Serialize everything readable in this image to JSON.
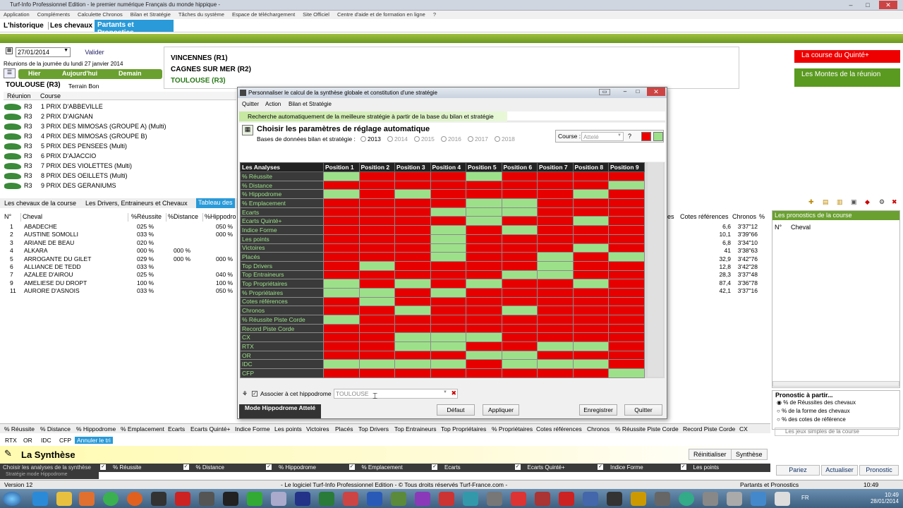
{
  "window": {
    "title": "Turf-Info Professionnel Edition - le premier numérique Français du monde hippique -"
  },
  "menu": [
    "Application",
    "Compléments",
    "Calculette Chronos",
    "Bilan et Stratégie",
    "Tâches du système",
    "Espace de téléchargement",
    "Site Officiel",
    "Centre d'aide et de formation en ligne",
    "?"
  ],
  "nav": {
    "historique": "L'historique",
    "chevaux": "Les chevaux",
    "partants": "Partants et Pronostics"
  },
  "date": {
    "value": "27/01/2014",
    "valider": "Valider",
    "reunions_label": "Réunions de la journée du lundi 27 janvier 2014",
    "hier": "Hier",
    "aujourdhui": "Aujourd'hui",
    "demain": "Demain"
  },
  "reunions": [
    "VINCENNES (R1)",
    "CAGNES SUR MER (R2)",
    "TOULOUSE (R3)"
  ],
  "selected": {
    "name": "TOULOUSE (R3)",
    "terrain": "Terrain Bon"
  },
  "courses_header": {
    "reunion": "Réunion",
    "course": "Course"
  },
  "courses": [
    {
      "r": "R3",
      "c": "1 PRIX D'ABBEVILLE"
    },
    {
      "r": "R3",
      "c": "2 PRIX D'AIGNAN"
    },
    {
      "r": "R3",
      "c": "3 PRIX DES MIMOSAS (GROUPE A) (Multi)"
    },
    {
      "r": "R3",
      "c": "4 PRIX DES MIMOSAS (GROUPE B)"
    },
    {
      "r": "R3",
      "c": "5 PRIX DES PENSEES (Multi)"
    },
    {
      "r": "R3",
      "c": "6 PRIX D'AJACCIO"
    },
    {
      "r": "R3",
      "c": "7 PRIX DES VIOLETTES (Multi)"
    },
    {
      "r": "R3",
      "c": "8 PRIX DES OEILLETS (Multi)"
    },
    {
      "r": "R3",
      "c": "9 PRIX DES GERANIUMS"
    }
  ],
  "right_links": {
    "quinte": "La course du Quinté+",
    "montes": "Les Montes de la réunion"
  },
  "tabs": {
    "chevaux": "Les chevaux de la course",
    "drivers": "Les Drivers, Entraineurs et Chevaux",
    "tableau": "Tableau des"
  },
  "horses_header": {
    "num": "N°",
    "cheval": "Cheval",
    "reussite": "%Réussite",
    "distance": "%Distance",
    "hippo": "%Hippodro"
  },
  "horses": [
    {
      "n": "1",
      "name": "ABADECHE",
      "r": "025 %",
      "d": "",
      "h": "050 %"
    },
    {
      "n": "2",
      "name": "AUSTINE SOMOLLI",
      "r": "033 %",
      "d": "",
      "h": "000 %"
    },
    {
      "n": "3",
      "name": "ARIANE DE BEAU",
      "r": "020 %",
      "d": "",
      "h": ""
    },
    {
      "n": "4",
      "name": "ALKARA",
      "r": "000 %",
      "d": "000 %",
      "h": ""
    },
    {
      "n": "5",
      "name": "ARROGANTE DU GILET",
      "r": "029 %",
      "d": "000 %",
      "h": "000 %"
    },
    {
      "n": "6",
      "name": "ALLIANCE DE TEDD",
      "r": "033 %",
      "d": "",
      "h": ""
    },
    {
      "n": "7",
      "name": "AZALEE D'AIROU",
      "r": "025 %",
      "d": "",
      "h": "040 %"
    },
    {
      "n": "9",
      "name": "AMELIESE DU DROPT",
      "r": "100 %",
      "d": "",
      "h": "100 %"
    },
    {
      "n": "11",
      "name": "AURORE D'ASNOIS",
      "r": "033 %",
      "d": "",
      "h": "050 %"
    }
  ],
  "right_table": {
    "h_es": "es",
    "h_cotes": "Cotes références",
    "h_chronos": "Chronos",
    "h_pct": "%",
    "rows": [
      {
        "cote": "6,6",
        "chrono": "3'37\"12"
      },
      {
        "cote": "10,1",
        "chrono": "3'39\"66"
      },
      {
        "cote": "6,8",
        "chrono": "3'34\"10"
      },
      {
        "cote": "41",
        "chrono": "3'38\"63"
      },
      {
        "cote": "32,9",
        "chrono": "3'42\"76"
      },
      {
        "cote": "12,8",
        "chrono": "3'42\"28"
      },
      {
        "cote": "28,3",
        "chrono": "3'37\"48"
      },
      {
        "cote": "87,4",
        "chrono": "3'36\"78"
      },
      {
        "cote": "42,1",
        "chrono": "3'37\"16"
      }
    ]
  },
  "pronostics": {
    "title": "Les pronostics de la course",
    "num": "N°",
    "cheval": "Cheval",
    "partir": "Pronostic à partir...",
    "opt1": "% de Réussites des chevaux",
    "opt2": "% de la forme des chevaux",
    "opt3": "% des cotes de référence",
    "jeux": "Les jeux simples de la course",
    "pariez": "Pariez",
    "actualiser": "Actualiser",
    "pronostic": "Pronostic"
  },
  "bottom_tabs": [
    "% Réussite",
    "% Distance",
    "% Hippodrome",
    "% Emplacement",
    "Ecarts",
    "Ecarts Quinté+",
    "Indice Forme",
    "Les points",
    "Victoires",
    "Placés",
    "Top Drivers",
    "Top Entraineurs",
    "Top Propriétaires",
    "% Propriétaires",
    "Cotes références",
    "Chronos",
    "% Réussite Piste Corde",
    "Record Piste Corde",
    "CX"
  ],
  "bottom_tabs2": [
    "RTX",
    "OR",
    "IDC",
    "CFP",
    "Annuler le tri"
  ],
  "synthese": {
    "title": "La Synthèse",
    "reinit": "Réinitialiser",
    "synthese": "Synthèse"
  },
  "analyse_bar": {
    "label": "Choisir les analyses de la synthèse",
    "label2": "Stratégie mode Hippodrome",
    "cols": [
      "% Réussite",
      "% Distance",
      "% Hippodrome",
      "% Emplacement",
      "Ecarts",
      "Ecarts Quinté+",
      "Indice Forme",
      "Les points"
    ]
  },
  "status": {
    "version": "Version 12",
    "copyright": "- Le logiciel Turf-Info Professionnel Edition - © Tous droits réservés Turf-France.com -",
    "section": "Partants et Pronostics",
    "time": "10:49"
  },
  "taskbar": {
    "lang": "FR",
    "time": "10:49",
    "date": "28/01/2014"
  },
  "dialog": {
    "title": "Personnaliser le calcul de la synthèse globale et constitution d'une stratégie",
    "menu": [
      "Quitter",
      "Action",
      "Bilan et Stratégie"
    ],
    "info": "Recherche automatiquement de la meilleure stratégie à partir de la base du bilan et stratégie",
    "heading": "Choisir les paramètres de réglage automatique",
    "base_label": "Bases de données bilan et stratégie :",
    "years": [
      "2013",
      "2014",
      "2015",
      "2016",
      "2017",
      "2018"
    ],
    "course_label": "Course :",
    "course_value": "Attelé",
    "grid_header": [
      "Les Analyses",
      "Position 1",
      "Position 2",
      "Position 3",
      "Position 4",
      "Position 5",
      "Position 6",
      "Position 7",
      "Position 8",
      "Position 9"
    ],
    "rows": [
      {
        "label": "% Réussite",
        "cells": "GRRRGRRRR"
      },
      {
        "label": "% Distance",
        "cells": "RRRRRRRRG"
      },
      {
        "label": "% Hippodrome",
        "cells": "GRGRRRRGR"
      },
      {
        "label": "% Emplacement",
        "cells": "RRRRGGRRR"
      },
      {
        "label": "Ecarts",
        "cells": "RRRGGGRRR"
      },
      {
        "label": "Ecarts Quinté+",
        "cells": "RRRRGRRGR"
      },
      {
        "label": "Indice Forme",
        "cells": "RRRGRGRRR"
      },
      {
        "label": "Les points",
        "cells": "RRRGRRRRR"
      },
      {
        "label": "Victoires",
        "cells": "RRRGRRRGR"
      },
      {
        "label": "Placés",
        "cells": "RRRGRRGRG"
      },
      {
        "label": "Top Drivers",
        "cells": "RGRRRRGRR"
      },
      {
        "label": "Top Entraineurs",
        "cells": "RRRRRGGRR"
      },
      {
        "label": "Top Propriétaires",
        "cells": "GRGRGRRGR"
      },
      {
        "label": "% Propriétaires",
        "cells": "GGRGRRRRR"
      },
      {
        "label": "Cotes références",
        "cells": "RGRRRRRRR"
      },
      {
        "label": "Chronos",
        "cells": "RRGRRGRRR"
      },
      {
        "label": "% Réussite Piste Corde",
        "cells": "GRRRRRRRR"
      },
      {
        "label": "Record Piste Corde",
        "cells": "RRRRRRRRR"
      },
      {
        "label": "CX",
        "cells": "RRGGGRRRR"
      },
      {
        "label": "RTX",
        "cells": "RRGGRRGGR"
      },
      {
        "label": "OR",
        "cells": "RRRRGGRRR"
      },
      {
        "label": "IDC",
        "cells": "GGGGRGGGR"
      },
      {
        "label": "CFP",
        "cells": "RRRRRRRRG"
      }
    ],
    "associer": "Associer à cet hippodrome",
    "hippodrome": "TOULOUSE",
    "mode": "Mode Hippodrome Attelé",
    "defaut": "Défaut",
    "appliquer": "Appliquer",
    "enregistrer": "Enregistrer",
    "quitter": "Quitter"
  },
  "colors": {
    "red": "#e60000",
    "green": "#9de08a",
    "nav_blue": "#2a9ad8",
    "brand_green": "#6aa030"
  }
}
